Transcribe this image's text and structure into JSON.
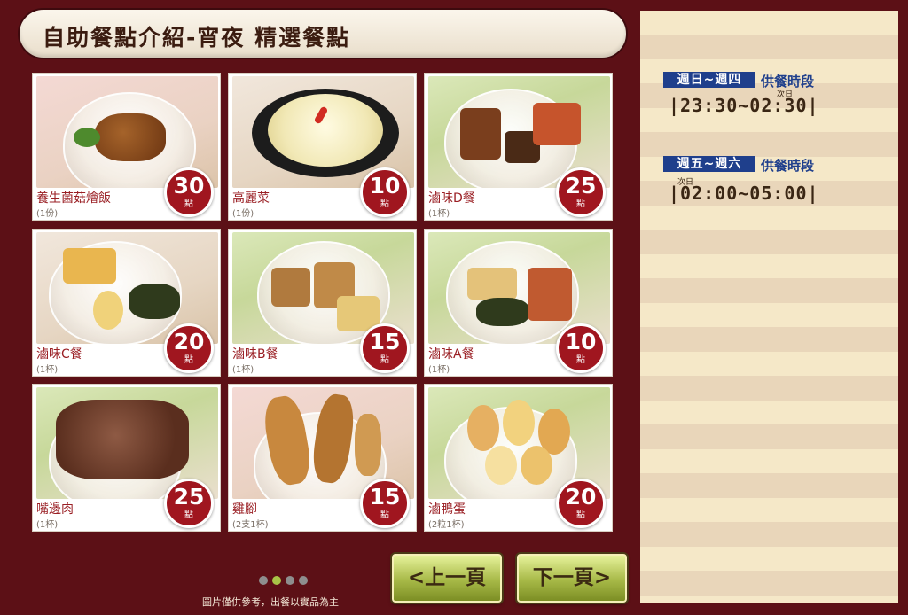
{
  "page": {
    "title": "自助餐點介紹-宵夜 精選餐點",
    "note": "圖片僅供參考，出餐以實品為主"
  },
  "items": [
    {
      "name": "養生菌菇燴飯",
      "unit": "(1份)",
      "price": "30",
      "points_label": "點",
      "icon": "mushroom-rice-photo"
    },
    {
      "name": "高麗菜",
      "unit": "(1份)",
      "price": "10",
      "points_label": "點",
      "icon": "cabbage-photo"
    },
    {
      "name": "滷味D餐",
      "unit": "(1杯)",
      "price": "25",
      "points_label": "點",
      "icon": "braised-d-photo"
    },
    {
      "name": "滷味C餐",
      "unit": "(1杯)",
      "price": "20",
      "points_label": "點",
      "icon": "braised-c-photo"
    },
    {
      "name": "滷味B餐",
      "unit": "(1杯)",
      "price": "15",
      "points_label": "點",
      "icon": "braised-b-photo"
    },
    {
      "name": "滷味A餐",
      "unit": "(1杯)",
      "price": "10",
      "points_label": "點",
      "icon": "braised-a-photo"
    },
    {
      "name": "嘴邊肉",
      "unit": "(1杯)",
      "price": "25",
      "points_label": "點",
      "icon": "pork-cheek-photo"
    },
    {
      "name": "雞腳",
      "unit": "(2支1杯)",
      "price": "15",
      "points_label": "點",
      "icon": "chicken-feet-photo"
    },
    {
      "name": "滷鴨蛋",
      "unit": "(2粒1杯)",
      "price": "20",
      "points_label": "點",
      "icon": "braised-duck-egg-photo"
    }
  ],
  "pager": {
    "count": 4,
    "active_index": 1
  },
  "nav": {
    "prev_label": "<上一頁",
    "next_label": "下一頁>"
  },
  "schedule": [
    {
      "days": "週日~週四",
      "label": "供餐時段",
      "time": "|23:30~02:30|",
      "next_day": "次日"
    },
    {
      "days": "週五~週六",
      "label": "供餐時段",
      "time": "|02:00~05:00|",
      "next_day": "次日"
    }
  ],
  "colors": {
    "background": "#5c1016",
    "price_badge": "#a0161f",
    "schedule_accent": "#1f3f8c",
    "nav_button": "#a7b947"
  }
}
